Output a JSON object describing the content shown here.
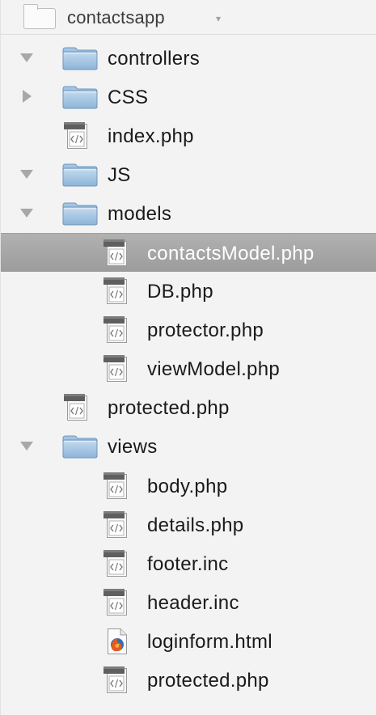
{
  "project": {
    "name": "contactsapp",
    "caret": "▾"
  },
  "tree": {
    "items": [
      {
        "label": "controllers",
        "kind": "folder",
        "expanded": true
      },
      {
        "label": "CSS",
        "kind": "folder",
        "expanded": false
      },
      {
        "label": "index.php",
        "kind": "php-file"
      },
      {
        "label": "JS",
        "kind": "folder",
        "expanded": true
      },
      {
        "label": "models",
        "kind": "folder",
        "expanded": true
      },
      {
        "label": "contactsModel.php",
        "kind": "php-file",
        "selected": true
      },
      {
        "label": "DB.php",
        "kind": "php-file"
      },
      {
        "label": "protector.php",
        "kind": "php-file"
      },
      {
        "label": "viewModel.php",
        "kind": "php-file"
      },
      {
        "label": "protected.php",
        "kind": "php-file"
      },
      {
        "label": "views",
        "kind": "folder",
        "expanded": true
      },
      {
        "label": "body.php",
        "kind": "php-file"
      },
      {
        "label": "details.php",
        "kind": "php-file"
      },
      {
        "label": "footer.inc",
        "kind": "php-file"
      },
      {
        "label": "header.inc",
        "kind": "php-file"
      },
      {
        "label": "loginform.html",
        "kind": "html-file"
      },
      {
        "label": "protected.php",
        "kind": "php-file"
      }
    ]
  },
  "colors": {
    "folder": "#8fb6d8",
    "selection": "#a6a6a6",
    "html_icon": "#e55b1d"
  }
}
